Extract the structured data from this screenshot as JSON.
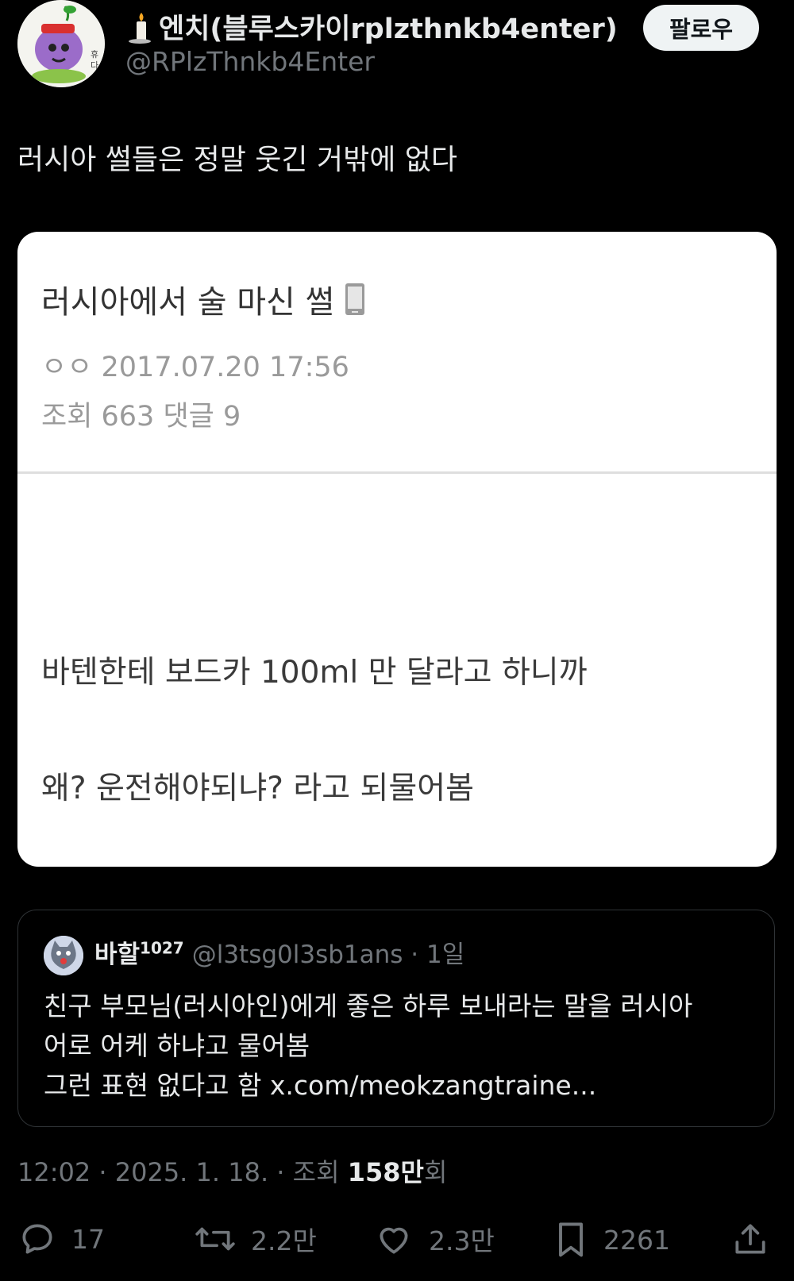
{
  "author": {
    "display_name": "엔치(블루스카이rplzthnkb4enter)",
    "handle": "@RPlzThnkb4Enter",
    "avatar_icon": "purple-character-avatar",
    "name_icon": "candle-icon"
  },
  "follow_label": "팔로우",
  "tweet_text": "러시아 썰들은 정말 웃긴 거밖에 없다",
  "media": {
    "title": "러시아에서 술 마신 썰",
    "title_icon": "phone-icon",
    "author_date": "ㅇㅇ 2017.07.20 17:56",
    "stats": "조회 663  댓글 9",
    "body_line1": "바텐한테 보드카 100ml 만 달라고 하니까",
    "body_line2": "왜? 운전해야되냐? 라고 되물어봄"
  },
  "quote": {
    "name": "바할",
    "name_sup": "1027",
    "handle_time": "@l3tsg0l3sb1ans · 1일",
    "line1": "친구 부모님(러시아인)에게 좋은 하루 보내라는 말을 러시아",
    "line2": "어로 어케 하냐고 물어봄",
    "line3": "그런 표현 없다고 함 x.com/meokzangtraine..."
  },
  "timestamp": {
    "prefix": "12:02 · 2025. 1. 18. · 조회 ",
    "views": "158만",
    "suffix": "회"
  },
  "actions": {
    "replies": "17",
    "retweets": "2.2만",
    "likes": "2.3만",
    "bookmarks": "2261"
  },
  "colors": {
    "background": "#000000",
    "text": "#e7e9ea",
    "muted": "#71767b",
    "card_bg": "#ffffff"
  }
}
